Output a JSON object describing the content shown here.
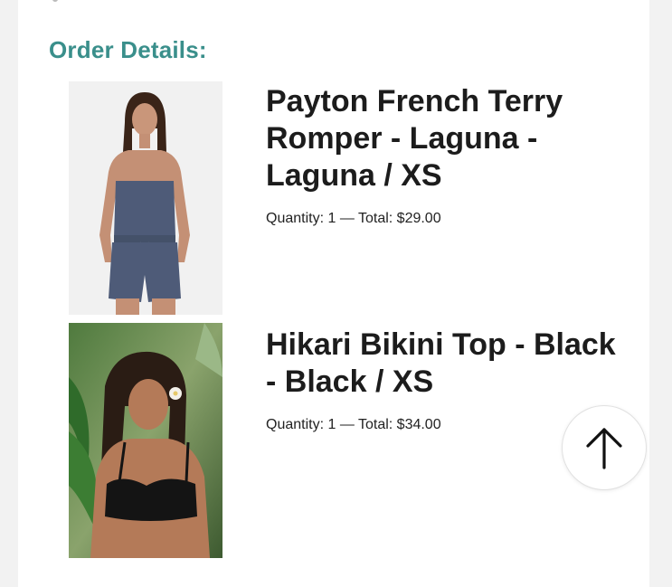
{
  "order": {
    "heading": "Order Details:",
    "items": [
      {
        "name": "Payton French Terry Romper - Laguna - Laguna / XS",
        "quantity_line": "Quantity: 1 — Total: $29.00",
        "image": "product-photo-romper"
      },
      {
        "name": "Hikari Bikini Top - Black - Black / XS",
        "quantity_line": "Quantity: 1 — Total: $34.00",
        "image": "product-photo-bikini"
      }
    ]
  },
  "scroll_button": {
    "icon": "arrow-up-icon"
  },
  "colors": {
    "heading": "#3a8f8b",
    "text": "#1c1c1c"
  }
}
